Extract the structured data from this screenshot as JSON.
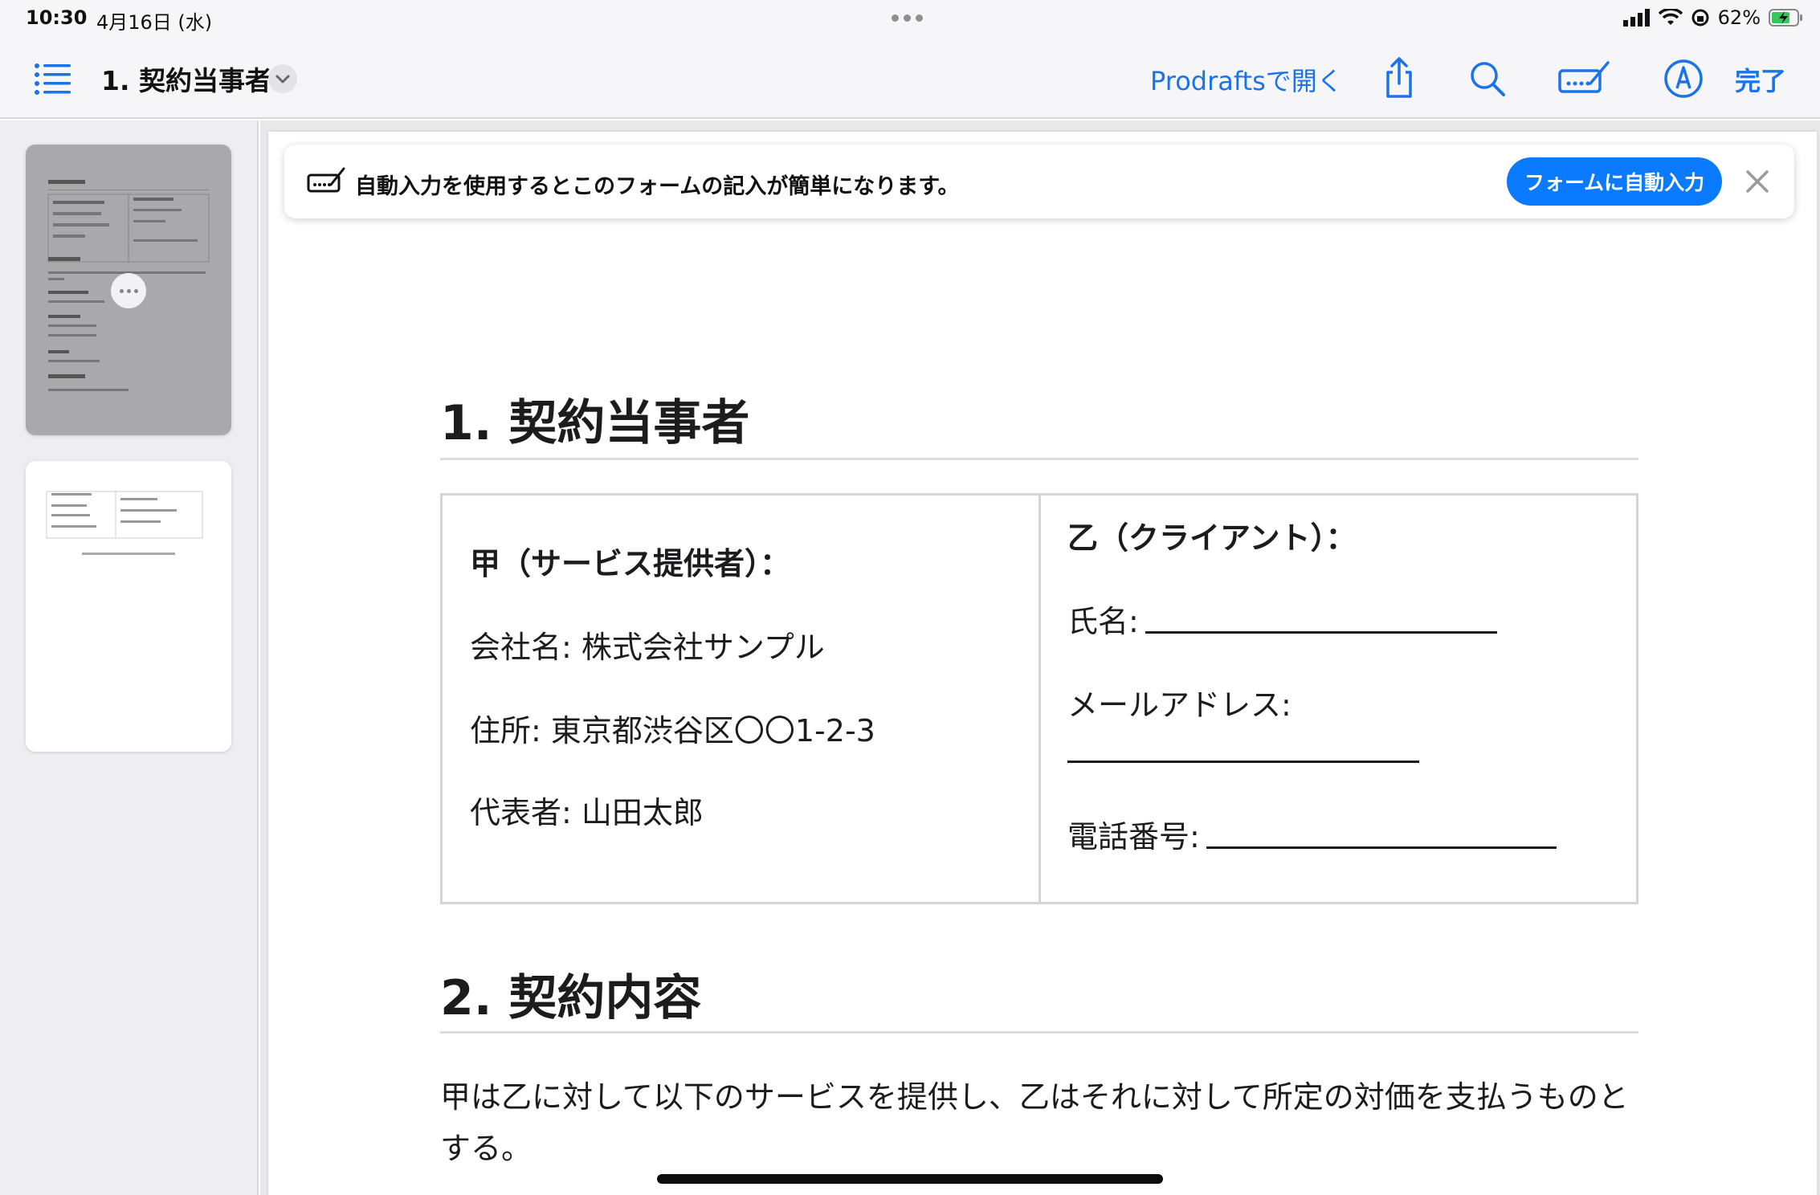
{
  "status_bar": {
    "time": "10:30",
    "date": "4月16日 (水)",
    "battery_percent": "62%"
  },
  "toolbar": {
    "title": "1. 契約当事者",
    "open_in_label": "Prodraftsで開く",
    "done_label": "完了",
    "accent_color": "#1a73e8"
  },
  "autofill_banner": {
    "message": "自動入力を使用するとこのフォームの記入が簡単になります。",
    "button_label": "フォームに自動入力",
    "button_color": "#0a7aff"
  },
  "document": {
    "section1_heading": "1. 契約当事者",
    "party_a": {
      "heading": "甲（サービス提供者）：",
      "company": "会社名: 株式会社サンプル",
      "address": "住所: 東京都渋谷区〇〇1-2-3",
      "representative": "代表者: 山田太郎"
    },
    "party_b": {
      "heading": "乙（クライアント）：",
      "name_label": "氏名:",
      "email_label": "メールアドレス:",
      "phone_label": "電話番号:"
    },
    "section2_heading": "2. 契約内容",
    "section2_body": "甲は乙に対して以下のサービスを提供し、乙はそれに対して所定の対価を支払うものとする。"
  },
  "thumbnails": [
    {
      "page": 1,
      "selected": true
    },
    {
      "page": 2,
      "selected": false
    }
  ]
}
